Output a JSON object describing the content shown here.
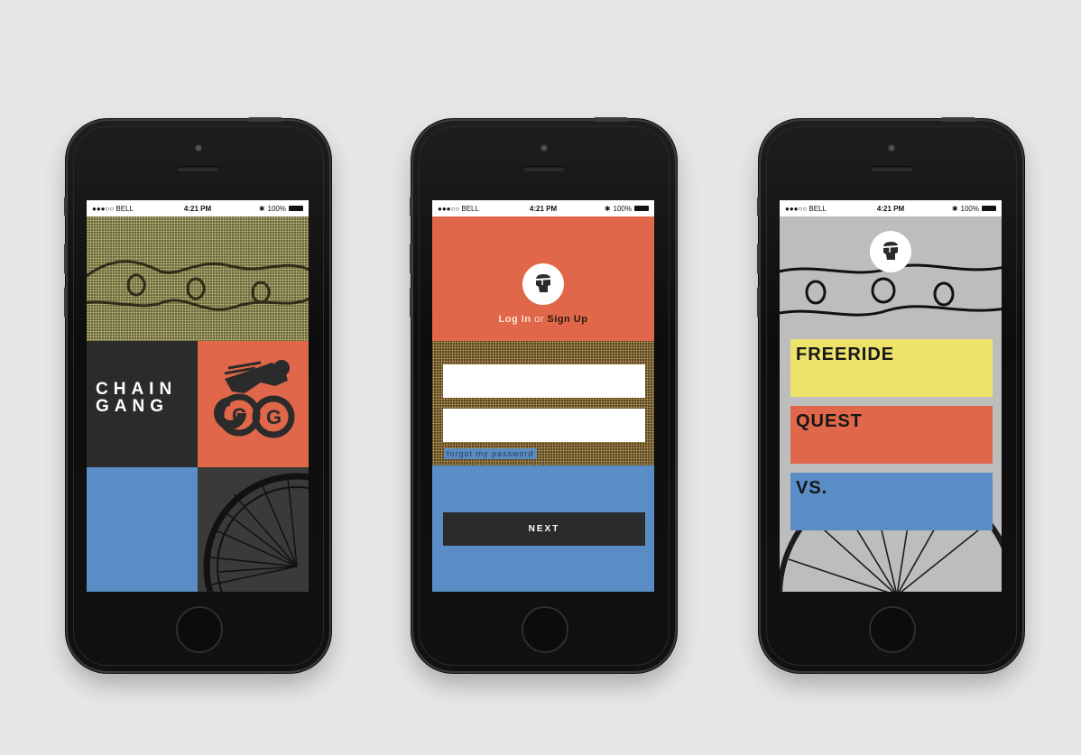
{
  "status_bar": {
    "carrier": "●●●○○ BELL",
    "time": "4:21 PM",
    "battery": "100%"
  },
  "screen1": {
    "title_line1": "CHAIN",
    "title_line2": "GANG"
  },
  "screen2": {
    "login_text": "Log In",
    "or_text": "or",
    "signup_text": "Sign Up",
    "username_value": "",
    "password_value": "",
    "forgot_label": "forgot my password",
    "next_label": "NEXT"
  },
  "screen3": {
    "cards": [
      {
        "label": "FREERIDE",
        "color": "#ede36a"
      },
      {
        "label": "QUEST",
        "color": "#e0674a"
      },
      {
        "label": "VS.",
        "color": "#5a8dc6"
      }
    ]
  },
  "colors": {
    "orange": "#e0674a",
    "blue": "#5a8dc6",
    "charcoal": "#2b2b2b",
    "olive": "#565230",
    "grey": "#bdbdbd",
    "yellow": "#ede36a"
  }
}
